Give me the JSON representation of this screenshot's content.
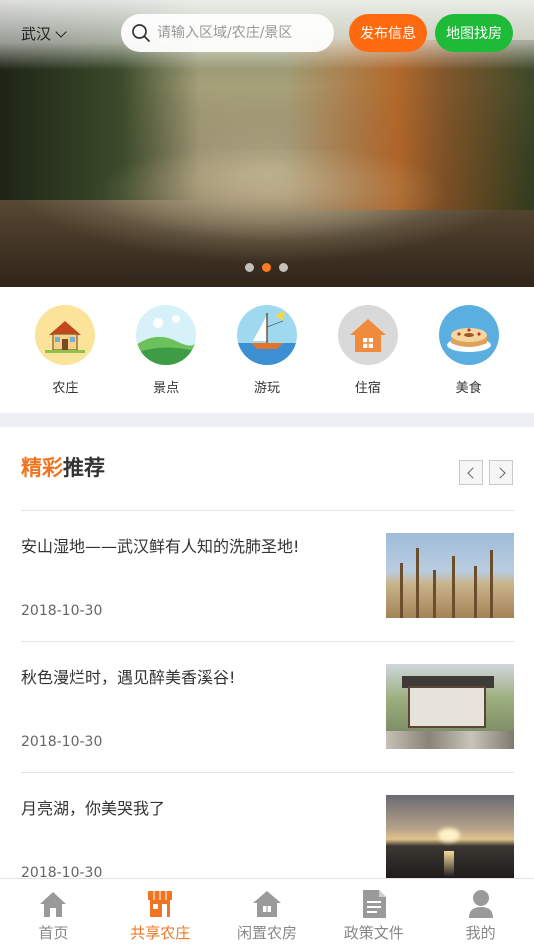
{
  "header": {
    "city": "武汉",
    "search_placeholder": "请输入区域/农庄/景区",
    "publish_label": "发布信息",
    "map_label": "地图找房"
  },
  "banner": {
    "dots": 3,
    "active_dot": 2
  },
  "categories": [
    {
      "label": "农庄",
      "icon": "farmhouse-icon"
    },
    {
      "label": "景点",
      "icon": "scenery-icon"
    },
    {
      "label": "游玩",
      "icon": "play-icon"
    },
    {
      "label": "住宿",
      "icon": "lodging-icon"
    },
    {
      "label": "美食",
      "icon": "food-icon"
    }
  ],
  "section": {
    "title_highlight": "精彩",
    "title_rest": "推荐"
  },
  "articles": [
    {
      "title": "安山湿地——武汉鲜有人知的洗肺圣地!",
      "date": "2018-10-30"
    },
    {
      "title": "秋色漫烂时，遇见醉美香溪谷!",
      "date": "2018-10-30"
    },
    {
      "title": "月亮湖，你美哭我了",
      "date": "2018-10-30"
    }
  ],
  "tabs": [
    {
      "label": "首页",
      "icon": "home-icon",
      "active": false
    },
    {
      "label": "共享农庄",
      "icon": "shop-icon",
      "active": true
    },
    {
      "label": "闲置农房",
      "icon": "house-icon",
      "active": false
    },
    {
      "label": "政策文件",
      "icon": "document-icon",
      "active": false
    },
    {
      "label": "我的",
      "icon": "user-icon",
      "active": false
    }
  ],
  "colors": {
    "accent_orange": "#f07522",
    "publish_button": "#ff6a10",
    "map_button": "#1dbb38",
    "inactive_tab": "#888888"
  }
}
